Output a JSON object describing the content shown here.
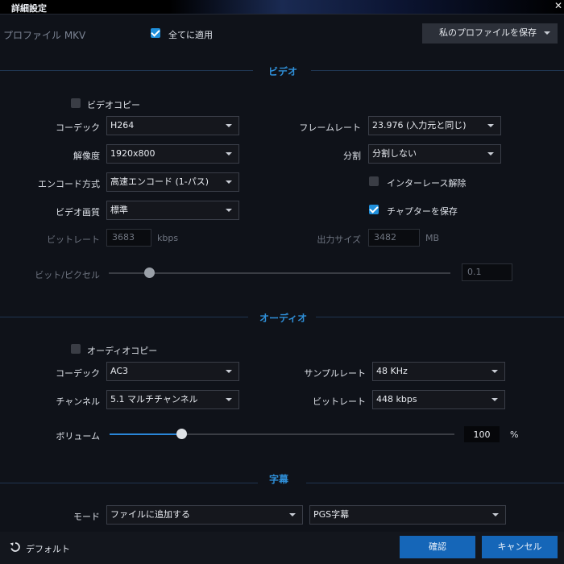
{
  "window": {
    "title": "詳細設定",
    "close_glyph": "✕"
  },
  "profile": {
    "name": "プロファイル MKV",
    "apply_all_label": "全てに適用",
    "apply_all_checked": true,
    "save_profile_label": "私のプロファイルを保存"
  },
  "video": {
    "section_title": "ビデオ",
    "copy_label": "ビデオコピー",
    "copy_checked": false,
    "codec_label": "コーデック",
    "codec_value": "H264",
    "resolution_label": "解像度",
    "resolution_value": "1920x800",
    "encode_label": "エンコード方式",
    "encode_value": "高速エンコード (1-パス)",
    "quality_label": "ビデオ画質",
    "quality_value": "標準",
    "bitrate_label": "ビットレート",
    "bitrate_value": "3683",
    "bitrate_unit": "kbps",
    "framerate_label": "フレームレート",
    "framerate_value": "23.976 (入力元と同じ)",
    "split_label": "分割",
    "split_value": "分割しない",
    "deinterlace_label": "インターレース解除",
    "deinterlace_checked": false,
    "chapters_label": "チャプターを保存",
    "chapters_checked": true,
    "output_size_label": "出力サイズ",
    "output_size_value": "3482",
    "output_size_unit": "MB",
    "bpp_label": "ビット/ピクセル",
    "bpp_value": "0.1",
    "bpp_slider_fraction": 0.12
  },
  "audio": {
    "section_title": "オーディオ",
    "copy_label": "オーディオコピー",
    "copy_checked": false,
    "codec_label": "コーデック",
    "codec_value": "AC3",
    "channel_label": "チャンネル",
    "channel_value": "5.1 マルチチャンネル",
    "samplerate_label": "サンプルレート",
    "samplerate_value": "48 KHz",
    "bitrate_label": "ビットレート",
    "bitrate_value": "448 kbps",
    "volume_label": "ボリューム",
    "volume_value": "100",
    "volume_unit": "%",
    "volume_slider_fraction": 0.21
  },
  "subtitles": {
    "section_title": "字幕",
    "mode_label": "モード",
    "mode_value": "ファイルに追加する",
    "format_value": "PGS字幕"
  },
  "footer": {
    "default_label": "デフォルト",
    "ok_label": "確認",
    "cancel_label": "キャンセル"
  },
  "colors": {
    "accent": "#2a86d8",
    "section_title": "#2f8fd8",
    "button": "#1566b8"
  }
}
